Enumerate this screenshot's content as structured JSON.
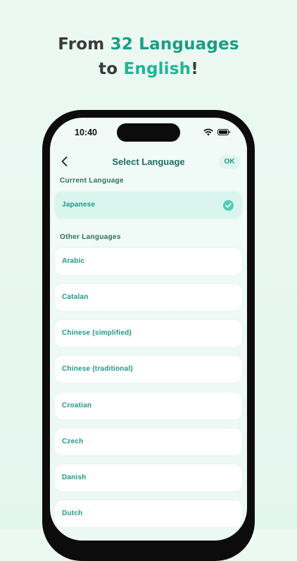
{
  "headline": {
    "line1_prefix": "From ",
    "line1_accent": "32 Languages",
    "line2_prefix": "to ",
    "line2_accent": "English",
    "line2_suffix": "!"
  },
  "status_bar": {
    "time": "10:40"
  },
  "nav": {
    "title": "Select Language",
    "ok_label": "OK"
  },
  "current_section": {
    "label": "Current Language",
    "language": "Japanese"
  },
  "other_section": {
    "label": "Other Languages",
    "languages": [
      "Arabic",
      "Catalan",
      "Chinese (simplified)",
      "Chinese (traditional)",
      "Croatian",
      "Czech",
      "Danish",
      "Dutch"
    ]
  },
  "colors": {
    "accent": "#1a9e84",
    "title": "#1c6f62",
    "selected_row": "#d9f5ee",
    "check": "#53cdb6"
  },
  "icons": {
    "back": "chevron-left-icon",
    "check": "check-circle-icon",
    "wifi": "wifi-icon",
    "battery": "battery-icon"
  }
}
